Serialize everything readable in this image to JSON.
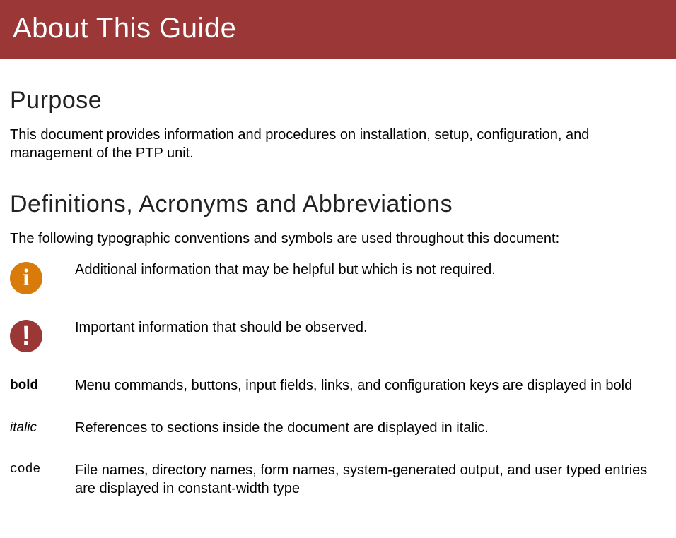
{
  "banner": {
    "title": "About This Guide"
  },
  "sections": {
    "purpose": {
      "heading": "Purpose",
      "text": "This document provides information and procedures on installation, setup, configuration, and management of the PTP unit."
    },
    "definitions": {
      "heading": "Definitions, Acronyms and Abbreviations",
      "intro": "The following typographic conventions and symbols are used throughout this document:",
      "conventions": [
        {
          "symbol_type": "info-icon",
          "desc": "Additional information that may be helpful but which is not required."
        },
        {
          "symbol_type": "important-icon",
          "desc": "Important information that should be observed."
        },
        {
          "symbol_type": "bold",
          "symbol_label": "bold",
          "desc": "Menu commands, buttons, input fields, links, and configuration keys are displayed in bold"
        },
        {
          "symbol_type": "italic",
          "symbol_label": "italic",
          "desc": "References to sections inside the document are displayed in italic."
        },
        {
          "symbol_type": "code",
          "symbol_label": "code",
          "desc": "File names, directory names, form names, system-generated output, and user typed entries are displayed in constant-width type"
        }
      ]
    }
  }
}
